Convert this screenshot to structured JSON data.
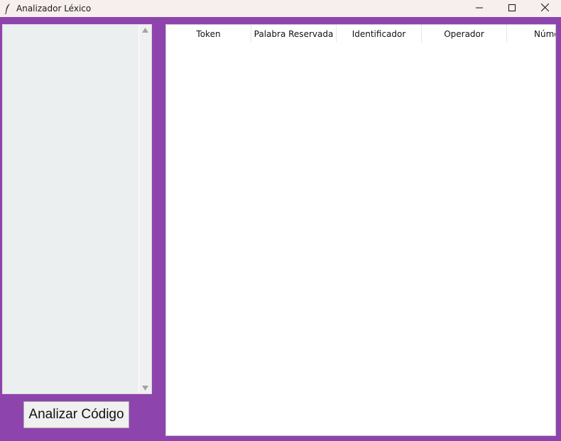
{
  "window": {
    "title": "Analizador Léxico",
    "icon": "feather-icon",
    "controls": [
      "minimize-icon",
      "maximize-icon",
      "close-icon"
    ]
  },
  "colors": {
    "background": "#8e44ad",
    "titlebar": "#f7eeee",
    "text_area": "#ebefef",
    "table": "#ffffff"
  },
  "editor": {
    "value": ""
  },
  "actions": {
    "analyze_label": "Analizar Código"
  },
  "table": {
    "columns": [
      "Token",
      "Palabra Reservada",
      "Identificador",
      "Operador",
      "Núme"
    ],
    "rows": []
  }
}
